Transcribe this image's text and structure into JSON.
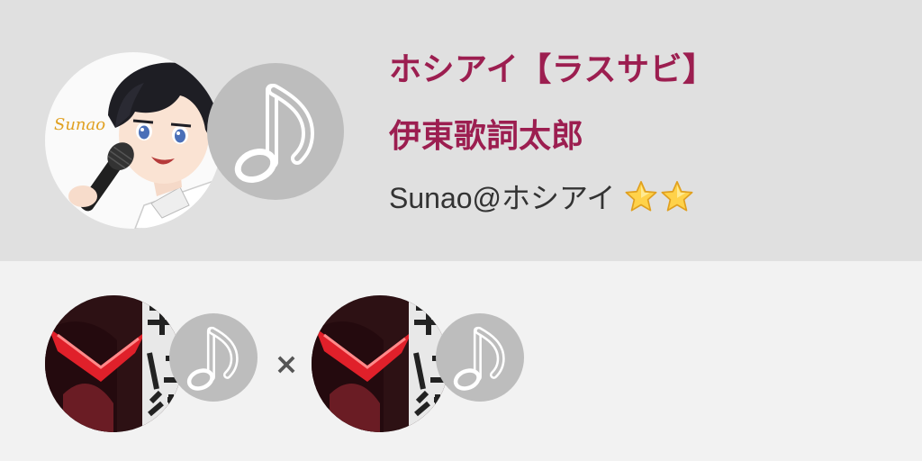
{
  "song": {
    "title": "ホシアイ【ラスサビ】",
    "artist": "伊東歌詞太郎"
  },
  "user": {
    "name": "Sunao@ホシアイ",
    "avatar_text": "Sunao",
    "rank_stars": 2
  },
  "duet": {
    "separator": "×"
  },
  "icons": {
    "note": "music-note-icon",
    "star": "star-icon"
  },
  "colors": {
    "title": "#9c1e50",
    "top_background": "#e0e0e0",
    "bottom_background": "#f2f2f2",
    "note_circle": "#bdbdbd"
  }
}
